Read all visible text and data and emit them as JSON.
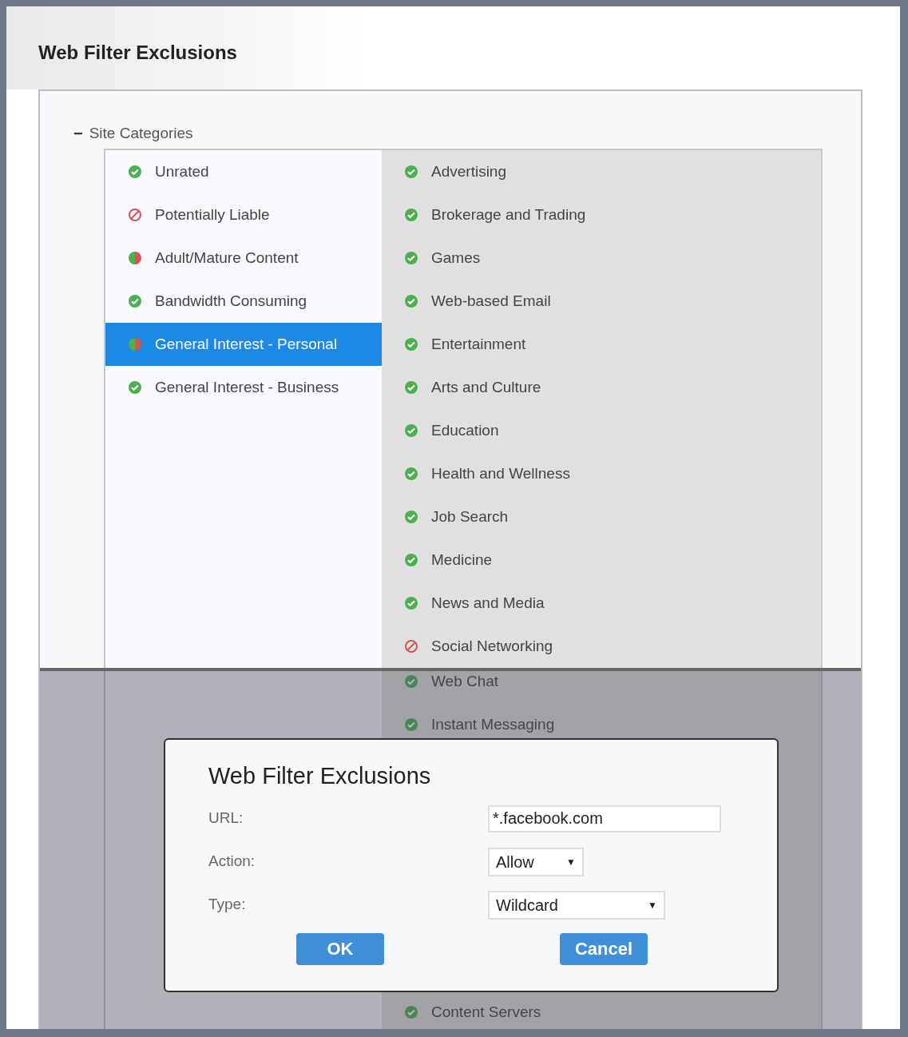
{
  "title": "Web Filter Exclusions",
  "tree": {
    "label": "Site Categories",
    "expanded": true,
    "expander": "−"
  },
  "groups": [
    {
      "label": "Unrated",
      "kind": "allow",
      "selected": false
    },
    {
      "label": "Potentially Liable",
      "kind": "block",
      "selected": false
    },
    {
      "label": "Adult/Mature Content",
      "kind": "mixed",
      "selected": false
    },
    {
      "label": "Bandwidth Consuming",
      "kind": "allow",
      "selected": false
    },
    {
      "label": "General Interest - Personal",
      "kind": "mixed",
      "selected": true
    },
    {
      "label": "General Interest - Business",
      "kind": "allow",
      "selected": false
    }
  ],
  "categories": [
    {
      "label": "Advertising",
      "kind": "allow"
    },
    {
      "label": "Brokerage and Trading",
      "kind": "allow"
    },
    {
      "label": "Games",
      "kind": "allow"
    },
    {
      "label": "Web-based Email",
      "kind": "allow"
    },
    {
      "label": "Entertainment",
      "kind": "allow"
    },
    {
      "label": "Arts and Culture",
      "kind": "allow"
    },
    {
      "label": "Education",
      "kind": "allow"
    },
    {
      "label": "Health and Wellness",
      "kind": "allow"
    },
    {
      "label": "Job Search",
      "kind": "allow"
    },
    {
      "label": "Medicine",
      "kind": "allow"
    },
    {
      "label": "News and Media",
      "kind": "allow"
    },
    {
      "label": "Social Networking",
      "kind": "block"
    }
  ],
  "categories_under_overlay": [
    {
      "label": "Web Chat",
      "kind": "allow"
    },
    {
      "label": "Instant Messaging",
      "kind": "allow"
    }
  ],
  "categories_below_dialog": [
    {
      "label": "Content Servers",
      "kind": "allow"
    }
  ],
  "dialog": {
    "title": "Web Filter Exclusions",
    "fields": [
      {
        "kind": "text",
        "label": "URL:",
        "value": "*.facebook.com"
      },
      {
        "kind": "select",
        "label": "Action:",
        "value": "Allow",
        "arrow": "▼"
      },
      {
        "kind": "select",
        "label": "Type:",
        "value": "Wildcard",
        "arrow": "▼"
      }
    ],
    "buttons": [
      {
        "label": "OK"
      },
      {
        "label": "Cancel"
      }
    ]
  }
}
